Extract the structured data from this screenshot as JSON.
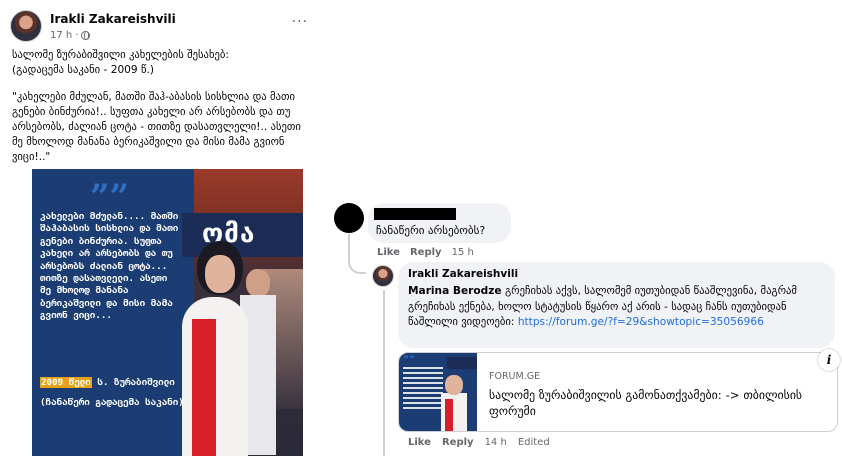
{
  "post": {
    "author": "Irakli Zakareishvili",
    "time": "17 h",
    "separator": "·",
    "more": "···",
    "text_line1": "სალომე ზურაბიშვილი კახელების შესახებ:",
    "text_line2": "(გადაცემა საკანი - 2009 წ.)",
    "quote": "\"კახელები მძულან, მათში შაჰ-აბასის სისხლია და მათი გენები ბინძურია!.. სუფთა კახელი არ არსებობს და თუ არსებობს, ძალიან ცოტა - თითზე დასათვლელი!.. ასეთი მე მხოლოდ მანანა ბერიკაშვილი და მისი მამა გვიონ ვიცი!..\""
  },
  "image": {
    "quote_mark": "””",
    "quote_text": "კახელები მძულან.... მათში შაჰაბასის სისხლია და მათი გენები ბინძურია. სუფთა კახელი არ არსებობს და თუ არსებობს ძალიან ცოტა... თითზე დასათვლელი. ასეთი მე მხოლოდ მანანა ბერიკაშვილი და მისი მამა გვიონ ვიცი...",
    "year": "2009 წელი",
    "author": " ს. ზურაბიშვილი",
    "source": "(ჩანაწერი გადაცემა საკანი)",
    "banner": "ომა"
  },
  "comment1": {
    "text": "ჩანაწერი არსებობს?",
    "like": "Like",
    "reply": "Reply",
    "time": "15 h"
  },
  "comment2": {
    "author": "Irakli Zakareishvili",
    "mention": "Marina Berodze",
    "text_before_link": " გრეჩიხას აქვს, სალომემ იუთუბიდან წააშლევინა, მაგრამ გრეჩიხას ექნება, ხოლო სტატუსის წყარო აქ არის - სადაც ჩანს იუთუბიდან წაშლილი ვიდეოები: ",
    "link": "https://forum.ge/?f=29&showtopic=35056966",
    "like": "Like",
    "reply": "Reply",
    "time": "14 h",
    "edited": "Edited"
  },
  "link_card": {
    "site": "FORUM.GE",
    "title": "სალომე ზურაბიშვილის გამონათქვამები: -> თბილისის ფორუმი",
    "info": "i"
  },
  "colors": {
    "link": "#216fdb",
    "bubble": "#f0f2f5",
    "secondary_text": "#65676b",
    "image_blue": "#1c3d73",
    "dress_red": "#d61f29"
  }
}
